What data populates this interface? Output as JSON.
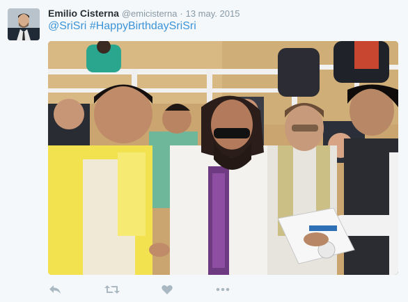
{
  "tweet": {
    "author_name": "Emilio Cisterna",
    "author_handle": "@emicisterna",
    "separator": "·",
    "date": "13 may. 2015",
    "mention": "@SriSri",
    "hashtag": "#HappyBirthdaySriSri"
  },
  "icons": {
    "reply": "reply-icon",
    "retweet": "retweet-icon",
    "like": "heart-icon",
    "more": "more-icon"
  },
  "colors": {
    "link": "#3b94d9",
    "muted": "#8899a6",
    "name": "#292f33",
    "action_icon": "#aab8c2"
  }
}
